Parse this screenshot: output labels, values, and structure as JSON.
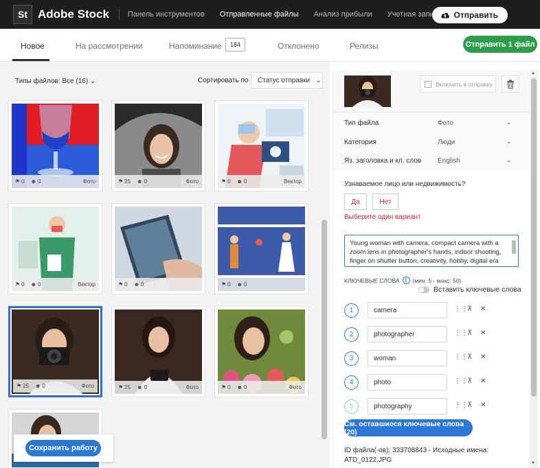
{
  "app": {
    "logo": "St",
    "name": "Adobe Stock"
  },
  "nav": {
    "links": [
      "Панель инструментов",
      "Отправленные файлы",
      "Анализ прибыли",
      "Учетная запись автора"
    ],
    "upload_label": "Отправить"
  },
  "tabs": {
    "items": [
      "Новое",
      "На рассмотрении",
      "Напоминание",
      "Отклонено",
      "Релизы"
    ],
    "reminder_count": "184",
    "send_one_label": "Отправить 1 файл"
  },
  "toolbar": {
    "file_types": "Типы файлов: Все (16)",
    "sort_label": "Сортировать по",
    "sort_value": "Статус отправки"
  },
  "tiles": [
    {
      "likes": "0",
      "users": "0",
      "type": "Фото"
    },
    {
      "likes": "25",
      "users": "0",
      "type": "Фото"
    },
    {
      "likes": "0",
      "users": "0",
      "type": "Вектор"
    },
    {
      "likes": "0",
      "users": "0",
      "type": "Вектор"
    },
    {
      "likes": "0",
      "users": "0",
      "type": ""
    },
    {
      "likes": "0",
      "users": "0",
      "type": ""
    },
    {
      "likes": "25",
      "users": "0",
      "type": "Фото"
    },
    {
      "likes": "25",
      "users": "0",
      "type": "Фото"
    },
    {
      "likes": "0",
      "users": "0",
      "type": "Фото"
    }
  ],
  "save_label": "Сохранить работу",
  "details": {
    "include_label": "Включить в отправку",
    "props": [
      {
        "label": "Тип файла",
        "value": "Фото"
      },
      {
        "label": "Категория",
        "value": "Люди"
      },
      {
        "label": "Яз. заголовка и кл. слов",
        "value": "English"
      }
    ],
    "question": "Узнаваемое лицо или недвижимость?",
    "yes": "Да",
    "no": "Нет",
    "error": "Выберите один вариант",
    "description": "Young woman with camera, compact camera with a zoom lens in photographer's hands, indoor shooting, finger on shutter button, creativity, hobby, digital era",
    "keywords_label": "КЛЮЧЕВЫЕ СЛОВА",
    "keywords_hint": "(мин: 5 - макс: 50)",
    "info_glyph": "i",
    "paste_label": "Вставить ключевые слова",
    "keywords": [
      {
        "n": "1",
        "word": "camera"
      },
      {
        "n": "2",
        "word": "photographer"
      },
      {
        "n": "3",
        "word": "woman"
      },
      {
        "n": "4",
        "word": "photo"
      },
      {
        "n": "5",
        "word": "photography"
      }
    ],
    "more_keywords": "См. оставшиеся ключевые слова (20)",
    "file_id_line1": "ID файла(-ов): 333708843 - Исходные имена:",
    "file_id_line2": "ATD_0122.JPG"
  },
  "colors": {
    "accent": "#2d78d3",
    "success": "#2d9d4a",
    "error": "#c8252a",
    "topbar": "#1e1e1e"
  },
  "icons": {
    "upload": "cloud-upload-icon",
    "trash": "trash-icon",
    "like": "tag-icon",
    "user": "users-icon",
    "drag": "drag-handle-icon",
    "move_top": "move-top-icon",
    "remove": "close-icon"
  }
}
